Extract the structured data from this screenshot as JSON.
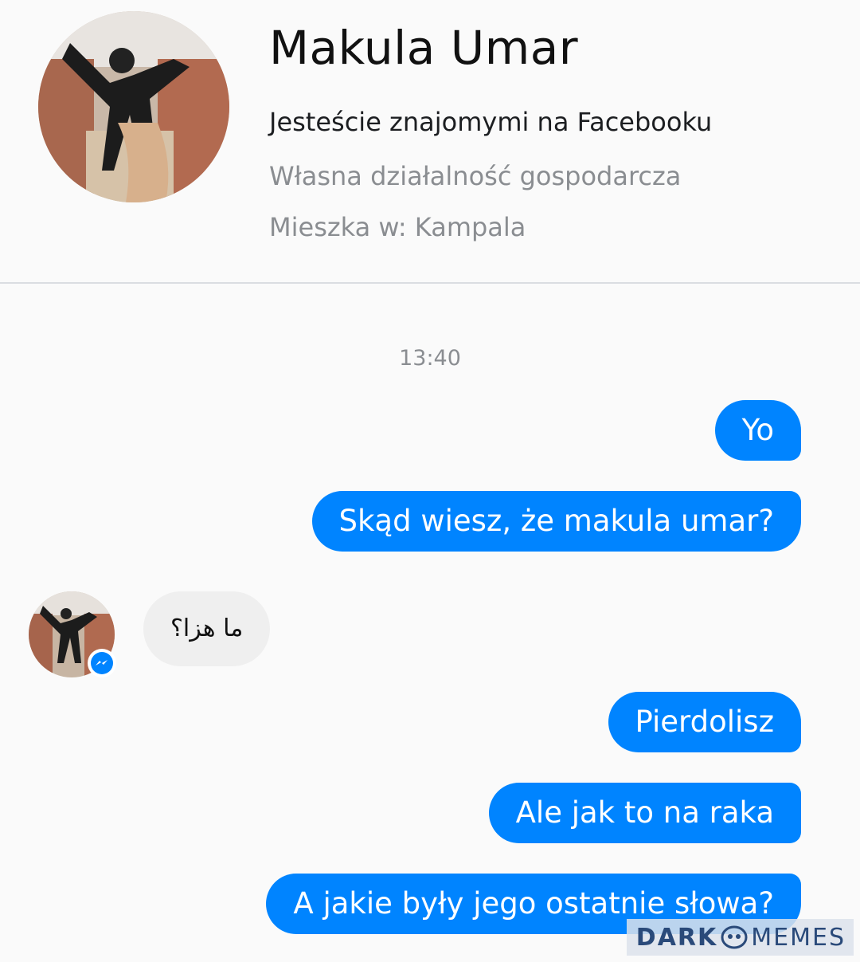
{
  "profile": {
    "name": "Makula Umar",
    "friends_text": "Jesteście znajomymi na Facebooku",
    "work": "Własna działalność gospodarcza",
    "lives_in": "Mieszka w: Kampala",
    "avatar_icon": "profile-photo"
  },
  "conversation": {
    "timestamp": "13:40",
    "messages": [
      {
        "direction": "outgoing",
        "text": "Yo"
      },
      {
        "direction": "outgoing",
        "text": "Skąd wiesz, że makula umar?"
      },
      {
        "direction": "incoming",
        "text": "ما هزا؟"
      },
      {
        "direction": "outgoing",
        "text": "Pierdolisz"
      },
      {
        "direction": "outgoing",
        "text": "Ale jak to na raka"
      },
      {
        "direction": "outgoing",
        "text": "A jakie były jego ostatnie słowa?"
      }
    ]
  },
  "watermark": {
    "part1": "DARK",
    "part2": "MEMES"
  },
  "colors": {
    "outgoing_bubble": "#0084ff",
    "incoming_bubble": "#efefef",
    "secondary_text": "#8a8d91",
    "messenger_badge": "#0084ff"
  }
}
